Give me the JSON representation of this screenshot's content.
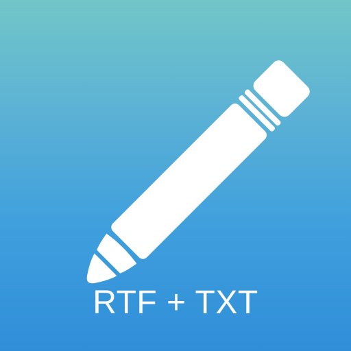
{
  "app_icon": {
    "icon_name": "pencil-icon",
    "caption": "RTF + TXT",
    "colors": {
      "gradient_top": "#72c6c8",
      "gradient_bottom": "#2f8ed8",
      "foreground": "#ffffff"
    }
  }
}
